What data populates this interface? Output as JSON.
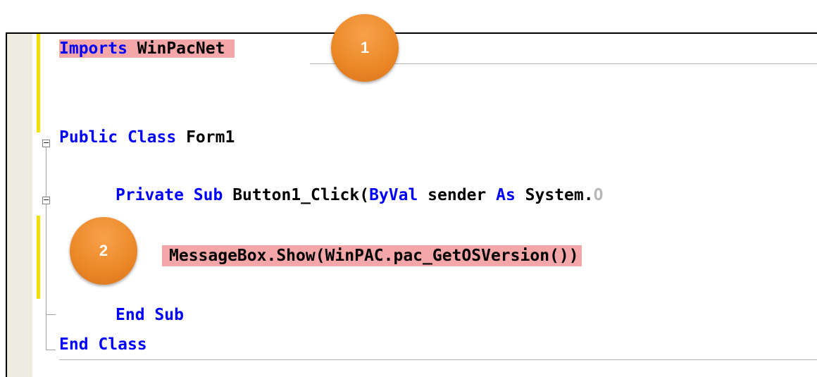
{
  "code": {
    "imports_keyword": "Imports",
    "imports_name": "WinPacNet",
    "class_public": "Public",
    "class_keyword": "Class",
    "class_name": "Form1",
    "sub_private": "Private",
    "sub_keyword": "Sub",
    "sub_name": "Button1_Click(",
    "byval_keyword": "ByVal",
    "sender_text": " sender ",
    "as_keyword": "As",
    "system_text": " System.",
    "system_faded": "O",
    "messagebox_line": "MessageBox.Show(WinPAC.pac_GetOSVersion())",
    "end_sub_end": "End",
    "end_sub_sub": "Sub",
    "end_class_end": "End",
    "end_class_class": "Class"
  },
  "callouts": {
    "badge1": "1",
    "badge2": "2"
  },
  "colors": {
    "keyword": "#0000ff",
    "highlight": "#f4a7a8",
    "badge": "#ec8a2a",
    "margin": "#eeece1",
    "change_bar": "#f3e000"
  }
}
